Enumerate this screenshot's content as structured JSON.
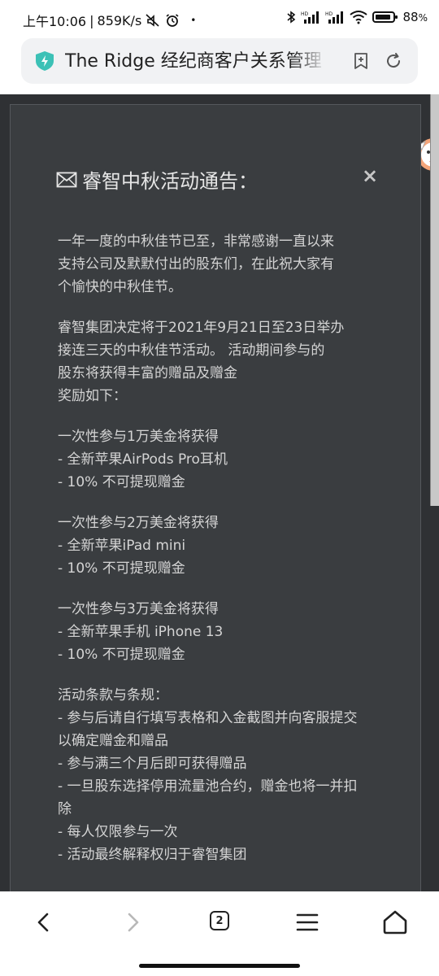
{
  "status_bar": {
    "time": "上午10:06",
    "net_speed": "859K/s",
    "battery": "88",
    "battery_unit": "%"
  },
  "address_bar": {
    "title": "The Ridge 经纪商客户关系管理"
  },
  "tabs": {
    "count": "2"
  },
  "modal": {
    "title": "睿智中秋活动通告：",
    "close_label": "×",
    "lines": [
      "一年一度的中秋佳节已至，非常感谢一直以来",
      "支持公司及默默付出的股东们，在此祝大家有",
      "个愉快的中秋佳节。",
      "睿智集团决定将于2021年9月21日至23日举办",
      "接连三天的中秋佳节活动。 活动期间参与的",
      "股东将获得丰富的赠品及赠金",
      "奖励如下：",
      "一次性参与1万美金将获得",
      "- 全新苹果AirPods Pro耳机",
      "- 10% 不可提现赠金",
      " 一次性参与2万美金将获得",
      " - 全新苹果iPad mini",
      "- 10% 不可提现赠金",
      " 一次性参与3万美金将获得",
      " - 全新苹果手机 iPhone 13",
      " - 10% 不可提现赠金",
      " 活动条款与条规：",
      " - 参与后请自行填写表格和入金截图并向客服提交",
      "以确定赠金和赠品",
      " - 参与满三个月后即可获得赠品",
      " - 一旦股东选择停用流量池合约，赠金也将一并扣",
      "除",
      " - 每人仅限参与一次",
      " - 活动最终解释权归于睿智集团"
    ]
  },
  "colors": {
    "page_bg": "#2f3134",
    "modal_bg": "#3a3d40",
    "modal_text": "#d4d4d4",
    "shield_accent": "#3cc1b6"
  }
}
